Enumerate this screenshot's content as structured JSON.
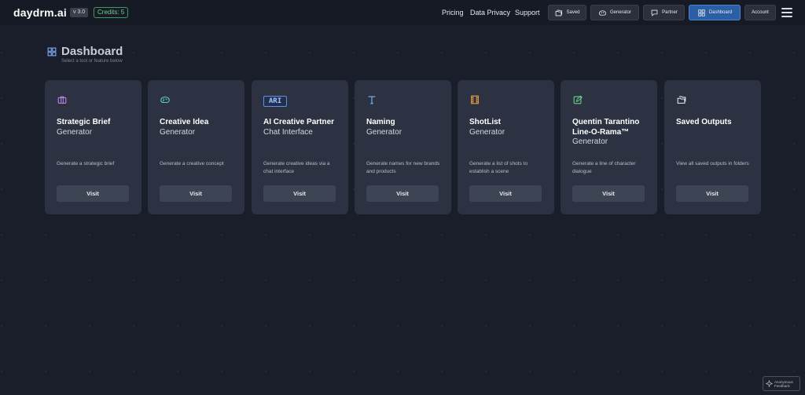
{
  "header": {
    "logo": "daydrm.ai",
    "version": "v 3.0",
    "credits": "Credits: 5",
    "links": [
      "Pricing",
      "Data Privacy",
      "Support"
    ],
    "buttons": {
      "saved": "Saved",
      "generator": "Generator",
      "partner": "Partner",
      "dashboard": "Dashboard",
      "account": "Account"
    }
  },
  "page": {
    "title": "Dashboard",
    "subtitle": "Select a tool or feature below"
  },
  "cards": [
    {
      "title": "Strategic Brief",
      "subtitle": "Generator",
      "description": "Generate a strategic brief",
      "button": "Visit",
      "icon": "briefcase-icon"
    },
    {
      "title": "Creative Idea",
      "subtitle": "Generator",
      "description": "Generate a creative concept",
      "button": "Visit",
      "icon": "brain-icon"
    },
    {
      "title": "AI Creative Partner",
      "subtitle": "Chat Interface",
      "description": "Generate creative ideas via a chat interface",
      "button": "Visit",
      "icon": "ari-badge",
      "badge": "ARI"
    },
    {
      "title": "Naming",
      "subtitle": "Generator",
      "description": "Generate names for new brands and products",
      "button": "Visit",
      "icon": "text-icon"
    },
    {
      "title": "ShotList",
      "subtitle": "Generator",
      "description": "Generate a list of shots to establish a scene",
      "button": "Visit",
      "icon": "film-icon"
    },
    {
      "title": "Quentin Tarantino Line-O-Rama™",
      "subtitle": "Generator",
      "description": "Generate a line of character dialogue",
      "button": "Visit",
      "icon": "edit-icon"
    },
    {
      "title": "Saved Outputs",
      "subtitle": "",
      "description": "View all saved outputs in folders",
      "button": "Visit",
      "icon": "folders-icon"
    }
  ],
  "feedback": {
    "line1": "Anonymous",
    "line2": "Feedback"
  },
  "colors": {
    "background": "#1a1e2b",
    "card": "#2c3241",
    "accent": "#2b5ea3",
    "credits": "#6fd08a"
  }
}
